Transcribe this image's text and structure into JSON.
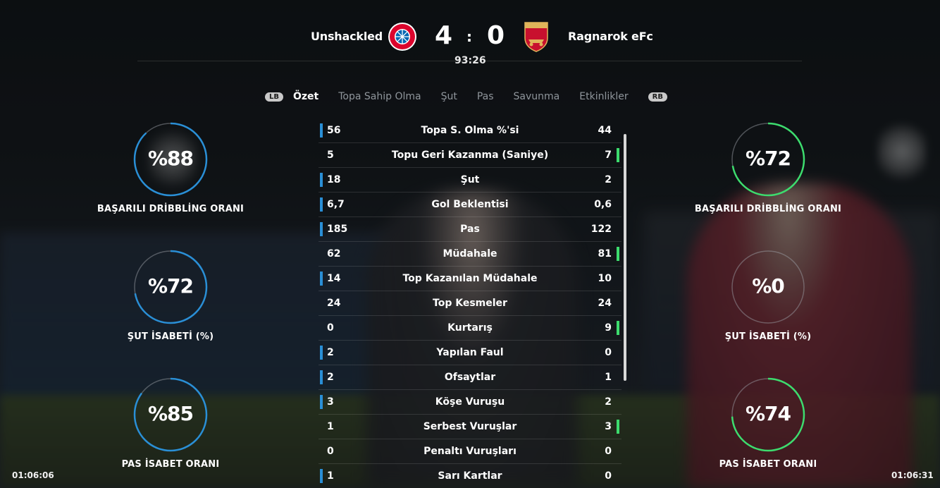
{
  "match": {
    "home_team": "Unshackled",
    "away_team": "Ragnarok eFc",
    "home_score": "4",
    "away_score": "0",
    "separator": ":",
    "clock": "93:26"
  },
  "colors": {
    "home_accent": "#2a8fd6",
    "away_accent": "#3ddc6e"
  },
  "tabs": {
    "lb": "LB",
    "rb": "RB",
    "items": [
      {
        "label": "Özet",
        "active": true
      },
      {
        "label": "Topa Sahip Olma",
        "active": false
      },
      {
        "label": "Şut",
        "active": false
      },
      {
        "label": "Pas",
        "active": false
      },
      {
        "label": "Savunma",
        "active": false
      },
      {
        "label": "Etkinlikler",
        "active": false
      }
    ]
  },
  "home_rings": [
    {
      "value": "%88",
      "label": "BAŞARILI DRİBBLİNG ORANI",
      "fraction": 0.88
    },
    {
      "value": "%72",
      "label": "ŞUT İSABETİ (%)",
      "fraction": 0.72
    },
    {
      "value": "%85",
      "label": "PAS İSABET ORANI",
      "fraction": 0.85
    }
  ],
  "away_rings": [
    {
      "value": "%72",
      "label": "BAŞARILI DRİBBLİNG ORANI",
      "fraction": 0.72
    },
    {
      "value": "%0",
      "label": "ŞUT İSABETİ (%)",
      "fraction": 0.0
    },
    {
      "value": "%74",
      "label": "PAS İSABET ORANI",
      "fraction": 0.74
    }
  ],
  "stats": [
    {
      "home": "56",
      "name": "Topa S. Olma %'si",
      "away": "44",
      "lead": "home"
    },
    {
      "home": "5",
      "name": "Topu Geri Kazanma (Saniye)",
      "away": "7",
      "lead": "away"
    },
    {
      "home": "18",
      "name": "Şut",
      "away": "2",
      "lead": "home"
    },
    {
      "home": "6,7",
      "name": "Gol Beklentisi",
      "away": "0,6",
      "lead": "home"
    },
    {
      "home": "185",
      "name": "Pas",
      "away": "122",
      "lead": "home"
    },
    {
      "home": "62",
      "name": "Müdahale",
      "away": "81",
      "lead": "away"
    },
    {
      "home": "14",
      "name": "Top Kazanılan Müdahale",
      "away": "10",
      "lead": "home"
    },
    {
      "home": "24",
      "name": "Top Kesmeler",
      "away": "24",
      "lead": "none"
    },
    {
      "home": "0",
      "name": "Kurtarış",
      "away": "9",
      "lead": "away"
    },
    {
      "home": "2",
      "name": "Yapılan Faul",
      "away": "0",
      "lead": "home"
    },
    {
      "home": "2",
      "name": "Ofsaytlar",
      "away": "1",
      "lead": "home"
    },
    {
      "home": "3",
      "name": "Köşe Vuruşu",
      "away": "2",
      "lead": "home"
    },
    {
      "home": "1",
      "name": "Serbest Vuruşlar",
      "away": "3",
      "lead": "away"
    },
    {
      "home": "0",
      "name": "Penaltı Vuruşları",
      "away": "0",
      "lead": "none"
    },
    {
      "home": "1",
      "name": "Sarı Kartlar",
      "away": "0",
      "lead": "home"
    }
  ],
  "timestamps": {
    "left": "01:06:06",
    "right": "01:06:31"
  }
}
